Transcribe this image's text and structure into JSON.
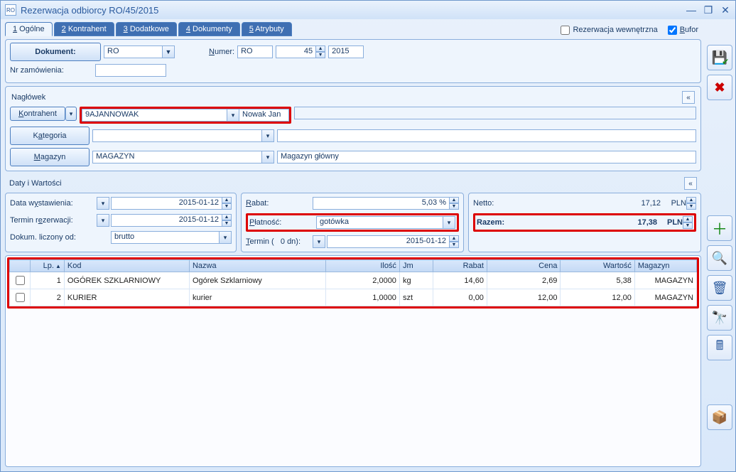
{
  "window": {
    "title": "Rezerwacja odbiorcy RO/45/2015",
    "icon_text": "RO"
  },
  "tabs": [
    {
      "prefix": "1",
      "label": " Ogólne",
      "active": true
    },
    {
      "prefix": "2",
      "label": " Kontrahent"
    },
    {
      "prefix": "3",
      "label": " Dodatkowe"
    },
    {
      "prefix": "4",
      "label": " Dokumenty"
    },
    {
      "prefix": "5",
      "label": " Atrybuty"
    }
  ],
  "top_checks": {
    "rezerwacja_label": "Rezerwacja wewnętrzna",
    "rezerwacja_checked": false,
    "bufor_label": "Bufor",
    "bufor_checked": true
  },
  "doc_panel": {
    "dokument_btn": "Dokument:",
    "dokument_value": "RO",
    "numer_label": "Numer:",
    "numer_prefix": "RO",
    "numer_value": "45",
    "numer_year": "2015",
    "nr_zamowienia_label": "Nr zamówienia:",
    "nr_zamowienia_value": ""
  },
  "naglowek": {
    "title": "Nagłówek",
    "kontrahent_btn": "Kontrahent",
    "kontrahent_code": "9AJANNOWAK",
    "kontrahent_name": "Nowak Jan",
    "kategoria_btn": "Kategoria",
    "kategoria_value": "",
    "kategoria_desc": "",
    "magazyn_btn": "Magazyn",
    "magazyn_code": "MAGAZYN",
    "magazyn_desc": "Magazyn główny"
  },
  "daty": {
    "title": "Daty i Wartości",
    "data_wyst_label": "Data wystawienia:",
    "data_wyst_value": "2015-01-12",
    "termin_rez_label": "Termin rezerwacji:",
    "termin_rez_value": "2015-01-12",
    "dokum_label": "Dokum. liczony od:",
    "dokum_value": "brutto",
    "rabat_label": "Rabat:",
    "rabat_value": "5,03 %",
    "platnosc_label": "Płatność:",
    "platnosc_value": "gotówka",
    "termin_label": "Termin (   0 dn):",
    "termin_value": "2015-01-12",
    "netto_label": "Netto:",
    "netto_value": "17,12",
    "razem_label": "Razem:",
    "razem_value": "17,38",
    "currency": "PLN"
  },
  "grid": {
    "columns": {
      "lp": "Lp.",
      "kod": "Kod",
      "nazwa": "Nazwa",
      "ilosc": "Ilość",
      "jm": "Jm",
      "rabat": "Rabat",
      "cena": "Cena",
      "wartosc": "Wartość",
      "magazyn": "Magazyn"
    },
    "rows": [
      {
        "lp": "1",
        "kod": "OGÓREK SZKLARNIOWY",
        "nazwa": "Ogórek Szklarniowy",
        "ilosc": "2,0000",
        "jm": "kg",
        "rabat": "14,60",
        "cena": "2,69",
        "wartosc": "5,38",
        "magazyn": "MAGAZYN"
      },
      {
        "lp": "2",
        "kod": "KURIER",
        "nazwa": "kurier",
        "ilosc": "1,0000",
        "jm": "szt",
        "rabat": "0,00",
        "cena": "12,00",
        "wartosc": "12,00",
        "magazyn": "MAGAZYN"
      }
    ]
  },
  "side_icons": {
    "save": "💾",
    "cancel": "✖",
    "add": "➕",
    "search": "🔍",
    "delete": "🗑",
    "find": "🔭",
    "calc": "📱",
    "discount": "📦"
  }
}
